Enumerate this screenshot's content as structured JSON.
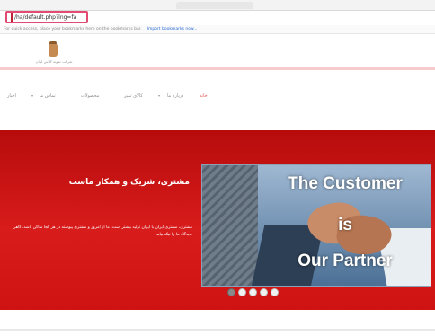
{
  "browser": {
    "address": {
      "url": "/ha/default.php?lng=fa"
    },
    "bookmarks_bar": {
      "message": "For quick access, place your bookmarks here on the bookmarks bar.",
      "import_link": "Import bookmarks now..."
    }
  },
  "header": {
    "logo_caption": "شرکت نمونه کلاس لبنان"
  },
  "nav": {
    "items": [
      {
        "label": "خانه",
        "active": true
      },
      {
        "label": "درباره ما",
        "active": false
      },
      {
        "label": "کالای تمیز",
        "active": false
      },
      {
        "label": "محصولات",
        "active": false
      },
      {
        "label": "تماس ما",
        "active": false
      },
      {
        "label": "اخبار",
        "active": false
      }
    ]
  },
  "hero": {
    "title": "مشتری، شریک و همکار ماست",
    "body": "مشتری، مشتری ایران با ایران تولید بیشتر است. ما از امروز و مشتری پیوسته در هر کجا ساکن باشد، گاهی دیدگاه ما را نیک بیابد.",
    "slide": {
      "line1": "The Customer",
      "line2": "is",
      "line3": "Our Partner"
    },
    "slide_count": 5,
    "active_slide": 1
  },
  "colors": {
    "accent": "#d81b1b",
    "address_highlight": "#e34a72"
  }
}
